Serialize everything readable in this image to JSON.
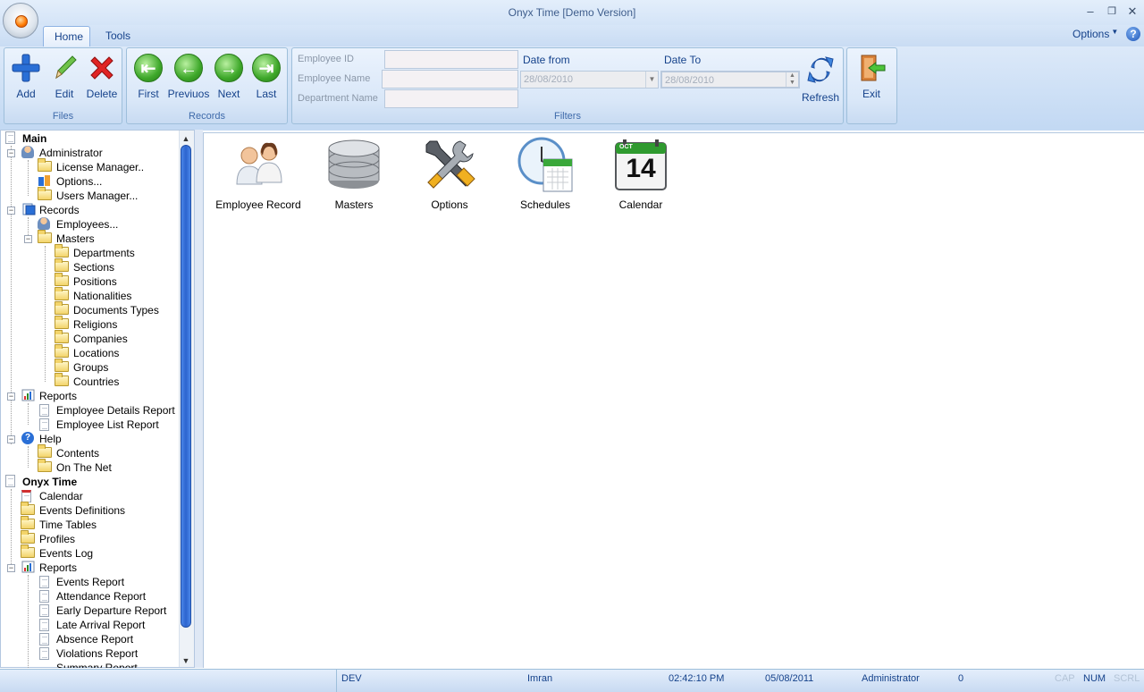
{
  "window": {
    "title": "Onyx Time [Demo Version]",
    "minimize": "–",
    "restore": "❐",
    "close": "✕"
  },
  "tabs": [
    {
      "label": "Home"
    },
    {
      "label": "Tools"
    }
  ],
  "options_menu": "Options",
  "help_glyph": "?",
  "ribbon": {
    "files": {
      "label": "Files",
      "buttons": [
        "Add",
        "Edit",
        "Delete"
      ]
    },
    "records": {
      "label": "Records",
      "buttons": [
        "First",
        "Previuos",
        "Next",
        "Last"
      ]
    },
    "filters": {
      "label": "Filters",
      "employee_id": "Employee ID",
      "employee_name": "Employee Name",
      "department_name": "Department Name",
      "date_from_label": "Date from",
      "date_to_label": "Date To",
      "date_from_value": "28/08/2010",
      "date_to_value": "28/08/2010",
      "refresh": "Refresh"
    },
    "exit": "Exit"
  },
  "tree": {
    "main": "Main",
    "administrator": "Administrator",
    "license_manager": "License Manager..",
    "options": "Options...",
    "users_manager": "Users Manager...",
    "records": "Records",
    "employees": "Employees...",
    "masters": "Masters",
    "masters_items": [
      "Departments",
      "Sections",
      "Positions",
      "Nationalities",
      "Documents Types",
      "Religions",
      "Companies",
      "Locations",
      "Groups",
      "Countries"
    ],
    "reports": "Reports",
    "report_items": [
      "Employee Details Report",
      "Employee List Report"
    ],
    "help": "Help",
    "help_items": [
      "Contents",
      "On The Net"
    ],
    "onyx_time": "Onyx Time",
    "onyx_items": [
      "Calendar",
      "Events Definitions",
      "Time Tables",
      "Profiles",
      "Events Log"
    ],
    "onyx_reports": "Reports",
    "onyx_report_items": [
      "Events Report",
      "Attendance Report",
      "Early Departure Report",
      "Late Arrival Report",
      "Absence Report",
      "Violations Report",
      "Summary Report"
    ]
  },
  "tiles": [
    {
      "label": "Employee Record",
      "icon": "employees-icon"
    },
    {
      "label": "Masters",
      "icon": "database-icon"
    },
    {
      "label": "Options",
      "icon": "tools-icon"
    },
    {
      "label": "Schedules",
      "icon": "clock-calendar-icon"
    },
    {
      "label": "Calendar",
      "icon": "calendar-icon"
    }
  ],
  "calendar_tile": {
    "month": "OCT",
    "day": "14"
  },
  "status": {
    "server": "DEV",
    "user": "Imran",
    "time": "02:42:10 PM",
    "date": "05/08/2011",
    "role": "Administrator",
    "count": "0",
    "cap": "CAP",
    "num": "NUM",
    "scrl": "SCRL"
  },
  "colors": {
    "accent": "#15428b",
    "ribbon": "#c3d9f3",
    "scroll": "#2c64cf"
  }
}
